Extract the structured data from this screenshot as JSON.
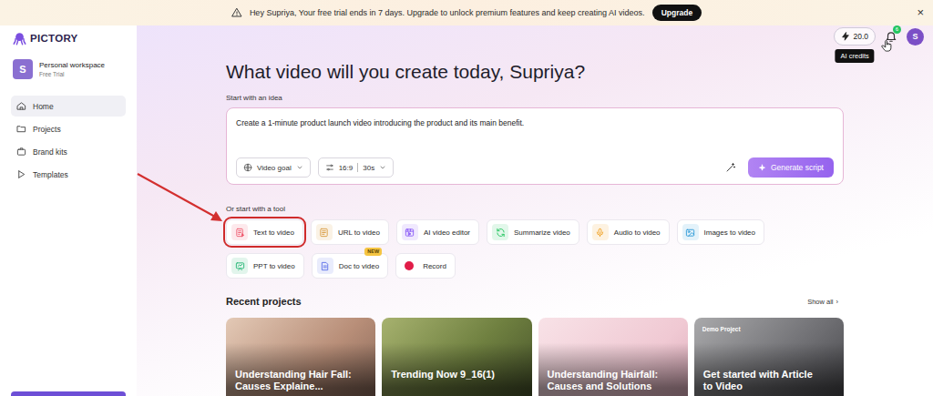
{
  "banner": {
    "message": "Hey Supriya, Your free trial ends in 7 days. Upgrade to unlock premium features and keep creating AI videos.",
    "button": "Upgrade",
    "close": "×"
  },
  "logo": {
    "text": "PICTORY"
  },
  "workspace": {
    "avatar": "S",
    "name": "Personal workspace",
    "plan": "Free Trial"
  },
  "sidebar": {
    "items": [
      {
        "label": "Home",
        "selected": true
      },
      {
        "label": "Projects",
        "selected": false
      },
      {
        "label": "Brand kits",
        "selected": false
      },
      {
        "label": "Templates",
        "selected": false
      }
    ]
  },
  "topbar": {
    "credits": "20.0",
    "tooltip": "AI credits",
    "notifications": "6",
    "avatar": "S"
  },
  "heading": "What video will you create today, Supriya?",
  "prompt": {
    "label": "Start with an idea",
    "text": "Create a 1-minute product launch video introducing the product and its main benefit.",
    "goal": "Video goal",
    "aspect": "16:9",
    "duration": "30s",
    "generate": "Generate script"
  },
  "tools": {
    "label": "Or start with a tool",
    "items": [
      {
        "label": "Text to video",
        "highlighted": true,
        "color": "#ef5b6e"
      },
      {
        "label": "URL to video",
        "highlighted": false,
        "color": "#d99a3e"
      },
      {
        "label": "AI video editor",
        "highlighted": false,
        "color": "#8b5cf6"
      },
      {
        "label": "Summarize video",
        "highlighted": false,
        "color": "#22c55e"
      },
      {
        "label": "Audio to video",
        "highlighted": false,
        "color": "#f0a020"
      },
      {
        "label": "Images to video",
        "highlighted": false,
        "color": "#2f9ad8"
      },
      {
        "label": "PPT to video",
        "highlighted": false,
        "color": "#22b573"
      },
      {
        "label": "Doc to video",
        "highlighted": false,
        "color": "#5b6ee8",
        "badge": "NEW"
      },
      {
        "label": "Record",
        "highlighted": false,
        "color": "#e11d48"
      }
    ]
  },
  "recent": {
    "title": "Recent projects",
    "show_all": "Show all",
    "show_all_icon": "›",
    "cards": [
      {
        "title": "Understanding Hair Fall: Causes Explaine..."
      },
      {
        "title": "Trending Now 9_16(1)"
      },
      {
        "title": "Understanding Hairfall: Causes and Solutions"
      },
      {
        "title": "Get started with Article to Video",
        "badge": "Demo Project"
      }
    ]
  }
}
